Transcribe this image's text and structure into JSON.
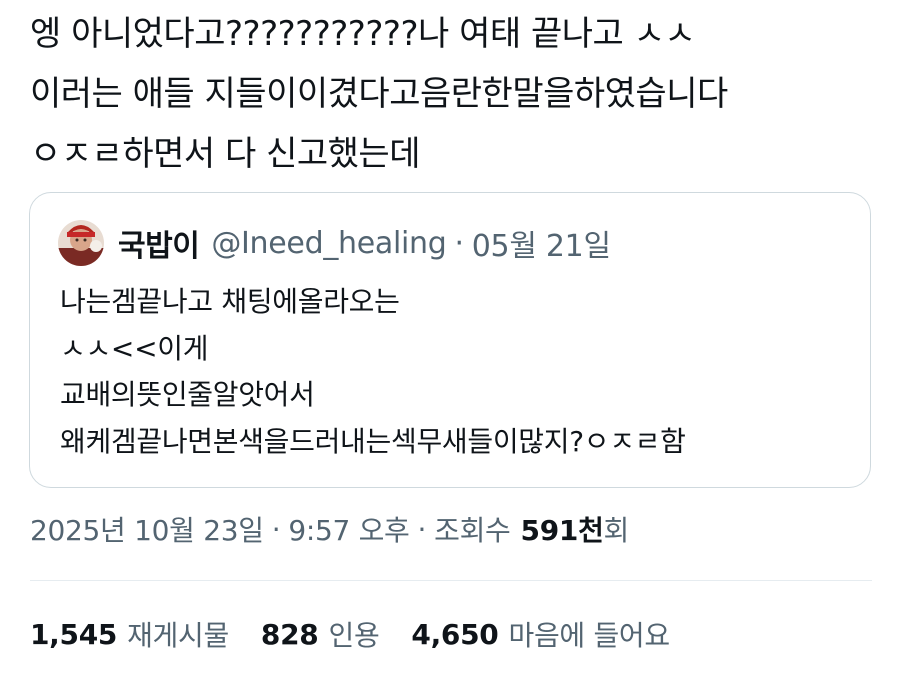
{
  "tweet": {
    "lines": [
      "엥 아니었다고???????????나 여태 끝나고 ㅅㅅ",
      "이러는 애들 지들이이겼다고음란한말을하였습니다",
      "ㅇㅈㄹ하면서 다 신고했는데"
    ]
  },
  "quote": {
    "avatar_icon": "profile-avatar",
    "display_name": "국밥이",
    "handle": "@Ineed_healing",
    "separator": "·",
    "date": "05월 21일",
    "lines": [
      "나는겜끝나고 채팅에올라오는",
      "ㅅㅅ<<이게",
      "교배의뜻인줄알앗어서",
      "왜케겜끝나면본색을드러내는섹무새들이많지?ㅇㅈㄹ함"
    ]
  },
  "meta": {
    "date": "2025년 10월 23일",
    "separator": "·",
    "time": "9:57 오후",
    "views_label": "조회수",
    "views_count": "591천",
    "views_suffix": "회"
  },
  "stats": {
    "reposts_count": "1,545",
    "reposts_label": "재게시물",
    "quotes_count": "828",
    "quotes_label": "인용",
    "likes_count": "4,650",
    "likes_label": "마음에 들어요"
  },
  "colors": {
    "text_primary": "#0f1419",
    "text_secondary": "#536471",
    "border": "#cfd9de",
    "divider": "#e6ecf0"
  }
}
